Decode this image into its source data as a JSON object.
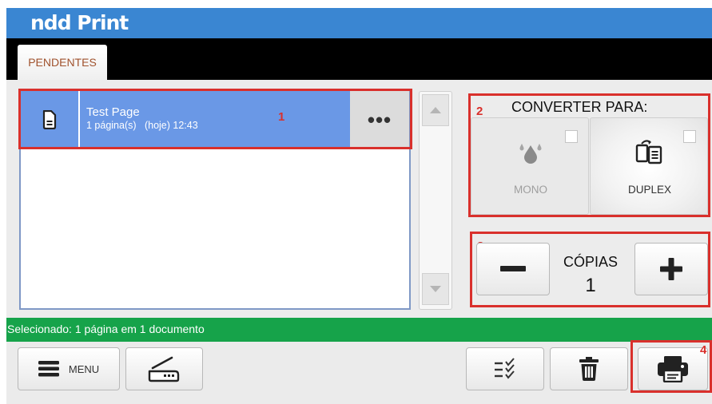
{
  "app": {
    "logo": "ndd Print"
  },
  "tabs": [
    {
      "label": "PENDENTES",
      "active": true
    }
  ],
  "job_list": {
    "items": [
      {
        "title": "Test Page",
        "pages": "1 página(s)",
        "time": "(hoje) 12:43",
        "selected": true
      }
    ],
    "more_label": "•••"
  },
  "markers": {
    "m1": "1",
    "m2": "2",
    "m3": "3",
    "m4": "4"
  },
  "convert": {
    "title": "CONVERTER PARA:",
    "options": [
      {
        "label": "MONO",
        "enabled": false,
        "checked": false
      },
      {
        "label": "DUPLEX",
        "enabled": true,
        "checked": false
      }
    ]
  },
  "copies": {
    "label": "CÓPIAS",
    "value": "1"
  },
  "status": {
    "text": "Selecionado: 1 página em 1 documento"
  },
  "bottom_bar": {
    "menu_label": "MENU"
  },
  "colors": {
    "header": "#3a86d2",
    "selection": "#6a98e6",
    "status": "#16a34a",
    "marker": "#d9302c"
  }
}
